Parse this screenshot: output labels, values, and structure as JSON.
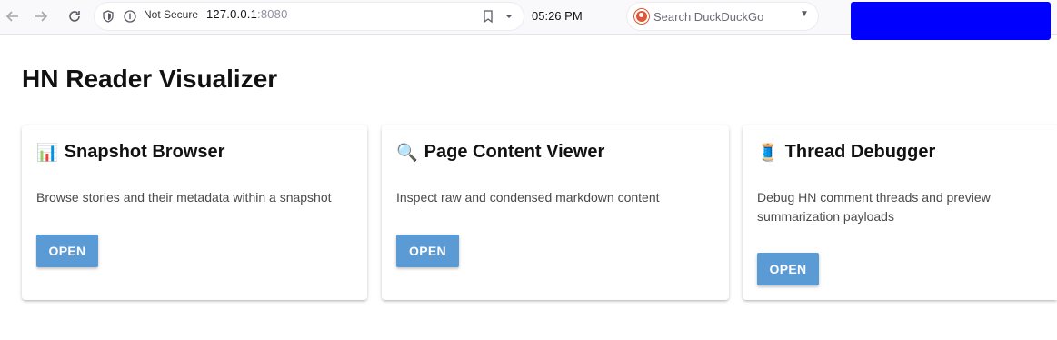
{
  "browser": {
    "security_label": "Not Secure",
    "url_host": "127.0.0.1",
    "url_port": ":8080",
    "clock": "05:26 PM",
    "search_placeholder": "Search DuckDuckGo",
    "overlay_color": "#0000ff"
  },
  "page": {
    "title": "HN Reader Visualizer"
  },
  "cards": [
    {
      "icon": "📊",
      "title": "Snapshot Browser",
      "description": "Browse stories and their metadata within a snapshot",
      "button": "OPEN"
    },
    {
      "icon": "🔍",
      "title": "Page Content Viewer",
      "description": "Inspect raw and condensed markdown content",
      "button": "OPEN"
    },
    {
      "icon": "🧵",
      "title": "Thread Debugger",
      "description": "Debug HN comment threads and preview summarization payloads",
      "button": "OPEN"
    }
  ],
  "colors": {
    "button": "#5b9bd5",
    "text": "#111111"
  }
}
